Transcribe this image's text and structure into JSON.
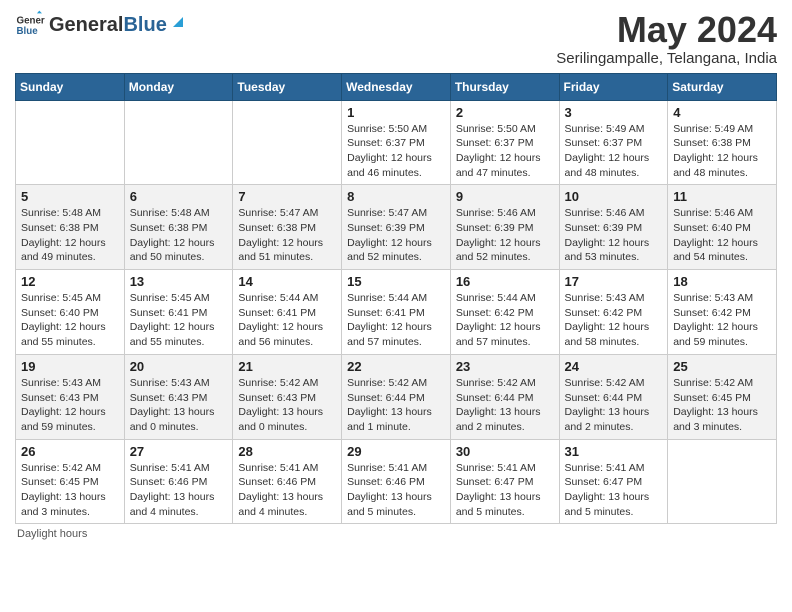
{
  "header": {
    "logo_general": "General",
    "logo_blue": "Blue",
    "month_year": "May 2024",
    "location": "Serilingampalle, Telangana, India"
  },
  "weekdays": [
    "Sunday",
    "Monday",
    "Tuesday",
    "Wednesday",
    "Thursday",
    "Friday",
    "Saturday"
  ],
  "weeks": [
    [
      {
        "day": "",
        "info": ""
      },
      {
        "day": "",
        "info": ""
      },
      {
        "day": "",
        "info": ""
      },
      {
        "day": "1",
        "info": "Sunrise: 5:50 AM\nSunset: 6:37 PM\nDaylight: 12 hours\nand 46 minutes."
      },
      {
        "day": "2",
        "info": "Sunrise: 5:50 AM\nSunset: 6:37 PM\nDaylight: 12 hours\nand 47 minutes."
      },
      {
        "day": "3",
        "info": "Sunrise: 5:49 AM\nSunset: 6:37 PM\nDaylight: 12 hours\nand 48 minutes."
      },
      {
        "day": "4",
        "info": "Sunrise: 5:49 AM\nSunset: 6:38 PM\nDaylight: 12 hours\nand 48 minutes."
      }
    ],
    [
      {
        "day": "5",
        "info": "Sunrise: 5:48 AM\nSunset: 6:38 PM\nDaylight: 12 hours\nand 49 minutes."
      },
      {
        "day": "6",
        "info": "Sunrise: 5:48 AM\nSunset: 6:38 PM\nDaylight: 12 hours\nand 50 minutes."
      },
      {
        "day": "7",
        "info": "Sunrise: 5:47 AM\nSunset: 6:38 PM\nDaylight: 12 hours\nand 51 minutes."
      },
      {
        "day": "8",
        "info": "Sunrise: 5:47 AM\nSunset: 6:39 PM\nDaylight: 12 hours\nand 52 minutes."
      },
      {
        "day": "9",
        "info": "Sunrise: 5:46 AM\nSunset: 6:39 PM\nDaylight: 12 hours\nand 52 minutes."
      },
      {
        "day": "10",
        "info": "Sunrise: 5:46 AM\nSunset: 6:39 PM\nDaylight: 12 hours\nand 53 minutes."
      },
      {
        "day": "11",
        "info": "Sunrise: 5:46 AM\nSunset: 6:40 PM\nDaylight: 12 hours\nand 54 minutes."
      }
    ],
    [
      {
        "day": "12",
        "info": "Sunrise: 5:45 AM\nSunset: 6:40 PM\nDaylight: 12 hours\nand 55 minutes."
      },
      {
        "day": "13",
        "info": "Sunrise: 5:45 AM\nSunset: 6:41 PM\nDaylight: 12 hours\nand 55 minutes."
      },
      {
        "day": "14",
        "info": "Sunrise: 5:44 AM\nSunset: 6:41 PM\nDaylight: 12 hours\nand 56 minutes."
      },
      {
        "day": "15",
        "info": "Sunrise: 5:44 AM\nSunset: 6:41 PM\nDaylight: 12 hours\nand 57 minutes."
      },
      {
        "day": "16",
        "info": "Sunrise: 5:44 AM\nSunset: 6:42 PM\nDaylight: 12 hours\nand 57 minutes."
      },
      {
        "day": "17",
        "info": "Sunrise: 5:43 AM\nSunset: 6:42 PM\nDaylight: 12 hours\nand 58 minutes."
      },
      {
        "day": "18",
        "info": "Sunrise: 5:43 AM\nSunset: 6:42 PM\nDaylight: 12 hours\nand 59 minutes."
      }
    ],
    [
      {
        "day": "19",
        "info": "Sunrise: 5:43 AM\nSunset: 6:43 PM\nDaylight: 12 hours\nand 59 minutes."
      },
      {
        "day": "20",
        "info": "Sunrise: 5:43 AM\nSunset: 6:43 PM\nDaylight: 13 hours\nand 0 minutes."
      },
      {
        "day": "21",
        "info": "Sunrise: 5:42 AM\nSunset: 6:43 PM\nDaylight: 13 hours\nand 0 minutes."
      },
      {
        "day": "22",
        "info": "Sunrise: 5:42 AM\nSunset: 6:44 PM\nDaylight: 13 hours\nand 1 minute."
      },
      {
        "day": "23",
        "info": "Sunrise: 5:42 AM\nSunset: 6:44 PM\nDaylight: 13 hours\nand 2 minutes."
      },
      {
        "day": "24",
        "info": "Sunrise: 5:42 AM\nSunset: 6:44 PM\nDaylight: 13 hours\nand 2 minutes."
      },
      {
        "day": "25",
        "info": "Sunrise: 5:42 AM\nSunset: 6:45 PM\nDaylight: 13 hours\nand 3 minutes."
      }
    ],
    [
      {
        "day": "26",
        "info": "Sunrise: 5:42 AM\nSunset: 6:45 PM\nDaylight: 13 hours\nand 3 minutes."
      },
      {
        "day": "27",
        "info": "Sunrise: 5:41 AM\nSunset: 6:46 PM\nDaylight: 13 hours\nand 4 minutes."
      },
      {
        "day": "28",
        "info": "Sunrise: 5:41 AM\nSunset: 6:46 PM\nDaylight: 13 hours\nand 4 minutes."
      },
      {
        "day": "29",
        "info": "Sunrise: 5:41 AM\nSunset: 6:46 PM\nDaylight: 13 hours\nand 5 minutes."
      },
      {
        "day": "30",
        "info": "Sunrise: 5:41 AM\nSunset: 6:47 PM\nDaylight: 13 hours\nand 5 minutes."
      },
      {
        "day": "31",
        "info": "Sunrise: 5:41 AM\nSunset: 6:47 PM\nDaylight: 13 hours\nand 5 minutes."
      },
      {
        "day": "",
        "info": ""
      }
    ]
  ],
  "footer": "Daylight hours"
}
